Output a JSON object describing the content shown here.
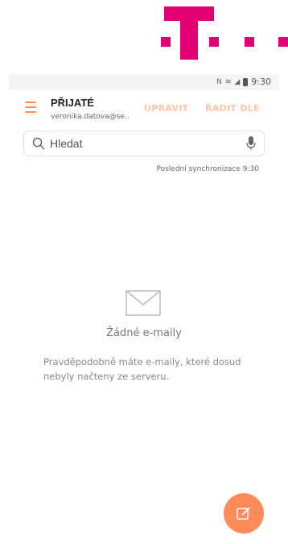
{
  "status_bar": {
    "time": "9:30",
    "icons": [
      "nfc-icon",
      "wifi-icon",
      "signal-icon",
      "battery-icon"
    ]
  },
  "header": {
    "title": "PŘIJATÉ",
    "account": "veronika.datova@se..",
    "actions": [
      "UPRAVIT",
      "ŘADIT DLE"
    ],
    "accent_color": "#ff8a5a"
  },
  "search": {
    "placeholder": "Hledat"
  },
  "sync": {
    "label": "Poslední synchronizace 9:30"
  },
  "empty_state": {
    "title": "Žádné e-maily",
    "description": "Pravděpodobně máte e-maily, které dosud nebyly načteny ze serveru."
  },
  "brand": {
    "color": "#e20074"
  }
}
